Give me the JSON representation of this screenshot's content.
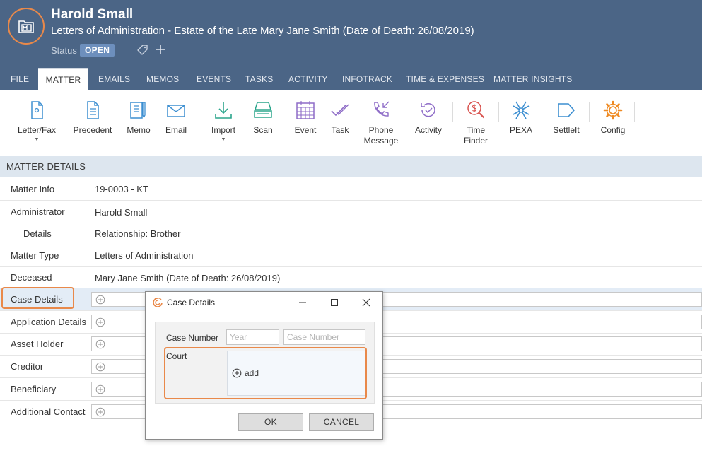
{
  "header": {
    "client_name": "Harold Small",
    "matter_title": "Letters of Administration - Estate of the Late Mary Jane Smith (Date of Death: 26/08/2019)",
    "status_label": "Status",
    "status_value": "OPEN"
  },
  "tabs": [
    {
      "label": "FILE"
    },
    {
      "label": "MATTER",
      "active": true
    },
    {
      "label": "EMAILS"
    },
    {
      "label": "MEMOS"
    },
    {
      "label": "EVENTS"
    },
    {
      "label": "TASKS"
    },
    {
      "label": "ACTIVITY"
    },
    {
      "label": "INFOTRACK"
    },
    {
      "label": "TIME & EXPENSES"
    },
    {
      "label": "MATTER INSIGHTS"
    }
  ],
  "ribbon": {
    "letter_fax": "Letter/Fax",
    "precedent": "Precedent",
    "memo": "Memo",
    "email": "Email",
    "import": "Import",
    "scan": "Scan",
    "event": "Event",
    "task": "Task",
    "phone_message_1": "Phone",
    "phone_message_2": "Message",
    "activity": "Activity",
    "time_finder_1": "Time",
    "time_finder_2": "Finder",
    "pexa": "PEXA",
    "settleit": "SettleIt",
    "config": "Config"
  },
  "section_header": "MATTER DETAILS",
  "details": {
    "matter_info_label": "Matter Info",
    "matter_info_value": "19-0003 - KT",
    "administrator_label": "Administrator",
    "administrator_value": "Harold Small",
    "details_label": "Details",
    "details_value": "Relationship: Brother",
    "matter_type_label": "Matter Type",
    "matter_type_value": "Letters of Administration",
    "deceased_label": "Deceased",
    "deceased_value": "Mary Jane Smith (Date of Death: 26/08/2019)",
    "case_details_label": "Case Details",
    "application_details_label": "Application Details",
    "asset_holder_label": "Asset Holder",
    "creditor_label": "Creditor",
    "beneficiary_label": "Beneficiary",
    "additional_contact_label": "Additional Contact"
  },
  "dialog": {
    "title": "Case Details",
    "case_number_label": "Case Number",
    "year_placeholder": "Year",
    "case_number_placeholder": "Case Number",
    "court_label": "Court",
    "add_label": "add",
    "ok_label": "OK",
    "cancel_label": "CANCEL"
  },
  "colors": {
    "header_bg": "#4b6586",
    "accent_orange": "#e9894a",
    "ribbon_icon_blue": "#3d8fd1",
    "ribbon_icon_teal": "#2ba58c",
    "ribbon_icon_purple": "#8e6cc7",
    "ribbon_icon_red": "#d9534f",
    "ribbon_icon_orange": "#ef8a22"
  },
  "icons": {
    "logo": "matter-folder-icon",
    "tag": "tag-icon",
    "add": "plus-icon",
    "row_add": "plus-circle-icon",
    "dialog_app": "app-swirl-icon",
    "minimize": "minimize-icon",
    "maximize": "maximize-icon",
    "close": "close-icon"
  }
}
